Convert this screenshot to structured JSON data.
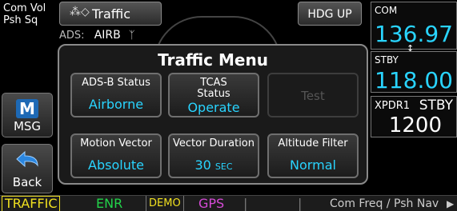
{
  "left": {
    "com_vol_label": "Com Vol",
    "psh_sq_label": "Psh Sq",
    "msg_label": "MSG",
    "back_label": "Back"
  },
  "map": {
    "traffic_tab_label": "Traffic",
    "ads_label": "ADS:",
    "ads_value": "AIRB",
    "hdg_label": "HDG UP"
  },
  "menu": {
    "title": "Traffic Menu",
    "buttons": [
      {
        "caption": "ADS-B Status",
        "value": "Airborne"
      },
      {
        "caption": "TCAS\nStatus",
        "value": "Operate"
      },
      {
        "caption": "",
        "value": "Test"
      },
      {
        "caption": "Motion Vector",
        "value": "Absolute"
      },
      {
        "caption": "Vector Duration",
        "value": "30",
        "unit": "SEC"
      },
      {
        "caption": "Altitude Filter",
        "value": "Normal"
      }
    ]
  },
  "right": {
    "com_label": "COM",
    "com_freq": "136.97",
    "stby_label": "STBY",
    "stby_freq": "118.00",
    "xpdr_label": "XPDR1",
    "xpdr_mode": "STBY",
    "xpdr_code": "1200"
  },
  "bottom": {
    "traffic": "TRAFFIC",
    "enr": "ENR",
    "demo": "DEMO",
    "gps": "GPS",
    "com_freq_hint": "Com Freq / Psh Nav"
  },
  "colors": {
    "cyan": "#29d4ff",
    "traffic_yellow": "#f0e020",
    "enr_green": "#22d34a",
    "gps_magenta": "#d54ad6"
  }
}
